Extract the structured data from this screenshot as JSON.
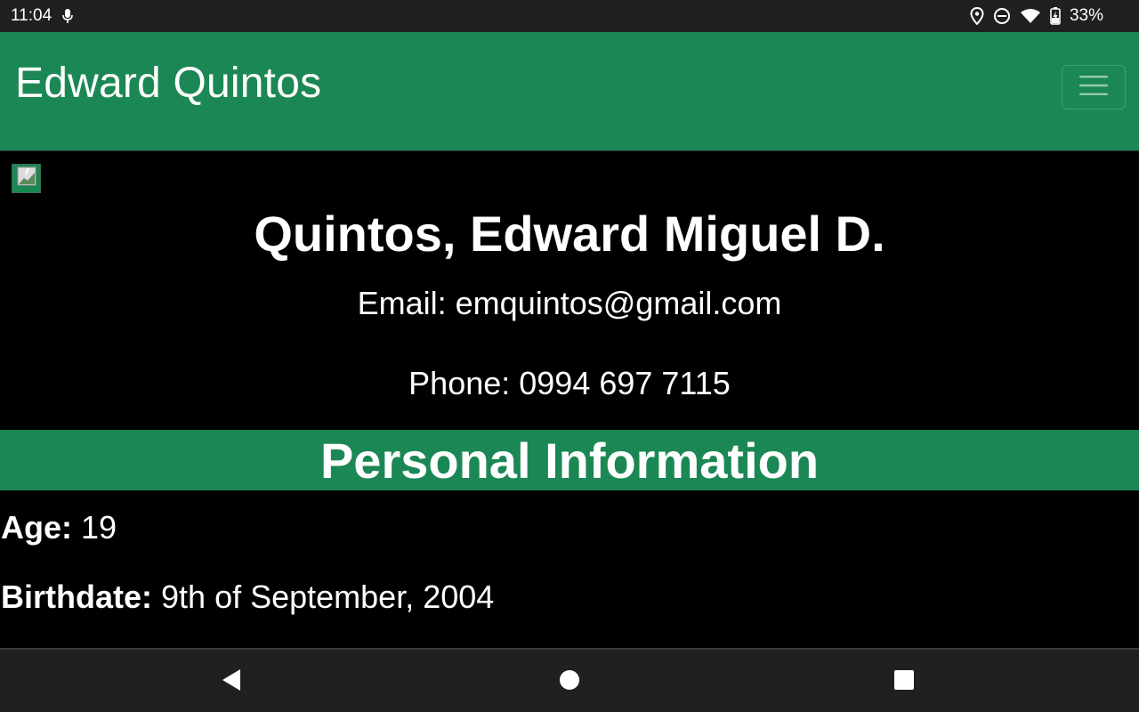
{
  "status_bar": {
    "time": "11:04",
    "battery": "33%",
    "icons": [
      "microphone-icon",
      "location-icon",
      "do-not-disturb-icon",
      "wifi-icon",
      "battery-charging-icon"
    ]
  },
  "header": {
    "brand": "Edward Quintos",
    "menu_icon": "hamburger-menu-icon"
  },
  "profile": {
    "image_icon": "broken-image-icon",
    "full_name": "Quintos, Edward Miguel D.",
    "email": "Email: emquintos@gmail.com",
    "phone": "Phone: 0994 697 7115"
  },
  "personal_information": {
    "title": "Personal Information",
    "age_label": "Age:",
    "age_value": "19",
    "birthdate_label": "Birthdate:",
    "birthdate_value": "9th of September, 2004"
  },
  "system_nav": {
    "icons": [
      "back-icon",
      "home-icon",
      "recents-icon"
    ]
  },
  "colors": {
    "accent": "#1b8754",
    "background": "#000000",
    "system_bar": "#202020",
    "text": "#ffffff"
  }
}
